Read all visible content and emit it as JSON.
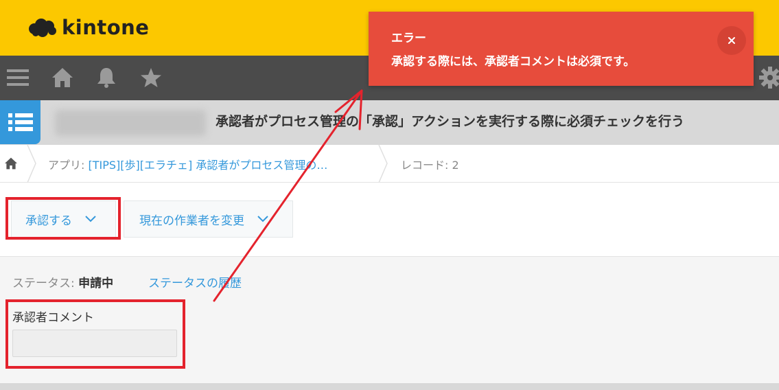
{
  "header": {
    "brand": "kintone"
  },
  "nav": {
    "icons": [
      "menu-icon",
      "home-icon",
      "bell-icon",
      "star-icon",
      "gear-icon"
    ]
  },
  "app": {
    "title": "承認者がプロセス管理の「承認」アクションを実行する際に必須チェックを行う"
  },
  "breadcrumb": {
    "app_prefix": "アプリ: ",
    "app_name": "[TIPS][歩][エラチェ] 承認者がプロセス管理の…",
    "record_label": "レコード: 2"
  },
  "actions": {
    "approve_label": "承認する",
    "change_assignee_label": "現在の作業者を変更"
  },
  "status": {
    "label": "ステータス: ",
    "value": "申請中",
    "history_link": "ステータスの履歴"
  },
  "comment": {
    "label": "承認者コメント",
    "value": ""
  },
  "toast": {
    "title": "エラー",
    "message": "承認する際には、承認者コメントは必須です。"
  },
  "colors": {
    "topbar": "#fcc800",
    "navbar": "#4b4b4b",
    "accent": "#3498db",
    "error": "#e74c3c",
    "annotation": "#e4232d"
  }
}
